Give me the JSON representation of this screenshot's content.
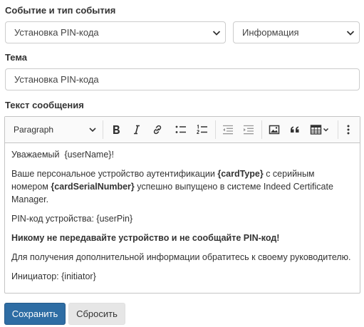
{
  "event_section": {
    "label": "Событие и тип события",
    "event_select": "Установка PIN-кода",
    "type_select": "Информация"
  },
  "subject_section": {
    "label": "Тема",
    "value": "Установка PIN-кода"
  },
  "message_section": {
    "label": "Текст сообщения",
    "toolbar": {
      "block_format": "Paragraph",
      "buttons": [
        "bold-icon",
        "italic-icon",
        "link-icon",
        "bulleted-list-icon",
        "numbered-list-icon",
        "outdent-icon",
        "indent-icon",
        "image-icon",
        "quote-icon",
        "table-icon",
        "more-icon"
      ]
    },
    "content": {
      "greeting": "Уважаемый  {userName}!",
      "p2_a": "Ваше персональное устройство аутентификации ",
      "p2_b": "{cardType}",
      "p2_c": " с серийным номером ",
      "p2_d": "{cardSerialNumber}",
      "p2_e": " успешно выпущено в системе Indeed Certificate Manager.",
      "pin_line": "PIN-код устройства: {userPin}",
      "warning": "Никому не передавайте устройство и не сообщайте PIN-код!",
      "contact": "Для получения дополнительной информации обратитесь к своему руководителю.",
      "initiator": "Инициатор: {initiator}"
    }
  },
  "actions": {
    "save": "Сохранить",
    "reset": "Сбросить"
  },
  "colors": {
    "primary": "#2e6da4",
    "secondary": "#e6e6e6"
  }
}
